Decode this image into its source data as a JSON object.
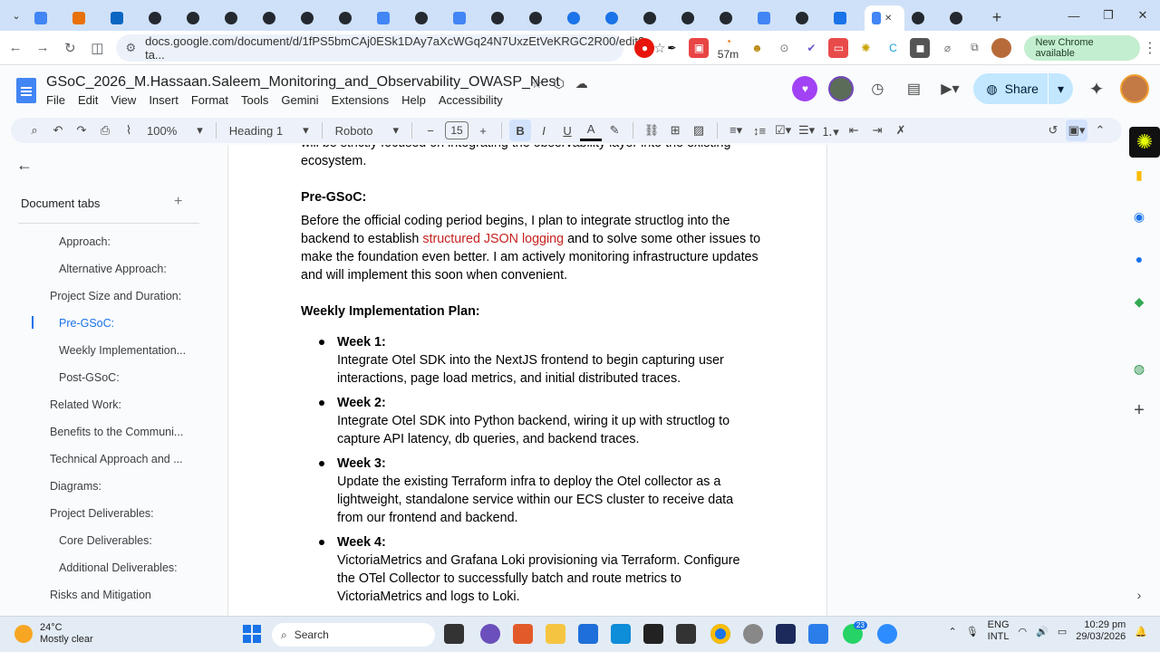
{
  "browser": {
    "active_tab_close": "✕",
    "url": "docs.google.com/document/d/1fPS5bmCAj0ESk1DAy7aXcWGq24N7UxzEtVeKRGC2R00/edit?ta...",
    "new_chrome_label": "New Chrome available",
    "extension_badge": "57m"
  },
  "docs": {
    "title": "GSoC_2026_M.Hassaan.Saleem_Monitoring_and_Observability_OWASP_Nest",
    "menus": [
      "File",
      "Edit",
      "View",
      "Insert",
      "Format",
      "Tools",
      "Gemini",
      "Extensions",
      "Help",
      "Accessibility"
    ],
    "share_label": "Share",
    "toolbar": {
      "zoom": "100%",
      "style": "Heading 1",
      "font": "Roboto",
      "font_size": "15"
    }
  },
  "sidebar": {
    "title": "Document tabs",
    "items": [
      {
        "label": "Approach:",
        "active": false
      },
      {
        "label": "Alternative Approach:",
        "active": false
      },
      {
        "label": "Project Size and Duration:",
        "active": false
      },
      {
        "label": "Pre-GSoC:",
        "active": true
      },
      {
        "label": "Weekly Implementation...",
        "active": false
      },
      {
        "label": "Post-GSoC:",
        "active": false
      },
      {
        "label": "Related Work:",
        "active": false
      },
      {
        "label": "Benefits to the Communi...",
        "active": false
      },
      {
        "label": "Technical Approach and ...",
        "active": false
      },
      {
        "label": "Diagrams:",
        "active": false
      },
      {
        "label": "Project Deliverables:",
        "active": false
      },
      {
        "label": "Core Deliverables:",
        "active": false
      },
      {
        "label": "Additional Deliverables:",
        "active": false
      },
      {
        "label": "Risks and Mitigation",
        "active": false
      }
    ]
  },
  "document": {
    "cut_line": "will be strictly focused on integrating the observability layer into the existing",
    "ecosystem_line": "ecosystem.",
    "pre_gsoc_heading": "Pre-GSoC:",
    "pre_gsoc_text_a": "Before the official coding period begins, I plan to integrate structlog into the backend to establish ",
    "pre_gsoc_link": "structured JSON logging",
    "pre_gsoc_text_b": " and to solve some other issues to make the foundation even better. I am actively monitoring infrastructure updates and will implement this soon when convenient.",
    "weekly_heading": "Weekly Implementation Plan:",
    "weeks": [
      {
        "title": "Week 1:",
        "text": "Integrate Otel SDK into the NextJS frontend to begin capturing user interactions, page load metrics, and initial distributed traces."
      },
      {
        "title": "Week 2:",
        "text": "Integrate Otel SDK into Python backend, wiring it up with structlog to capture API latency, db queries, and backend traces."
      },
      {
        "title": "Week 3:",
        "text": "Update the existing Terraform infra to deploy the Otel collector as a lightweight,  standalone service within our ECS cluster to receive data from our frontend and backend."
      },
      {
        "title": "Week 4:",
        "text": "VictoriaMetrics and Grafana Loki provisioning via Terraform. Configure the OTel Collector to successfully batch and route metrics to VictoriaMetrics and logs to Loki."
      }
    ]
  },
  "taskbar": {
    "weather_temp": "24°C",
    "weather_desc": "Mostly clear",
    "search_label": "Search",
    "lang_top": "ENG",
    "lang_bottom": "INTL",
    "time": "10:29 pm",
    "date": "29/03/2026",
    "whatsapp_badge": "23"
  }
}
